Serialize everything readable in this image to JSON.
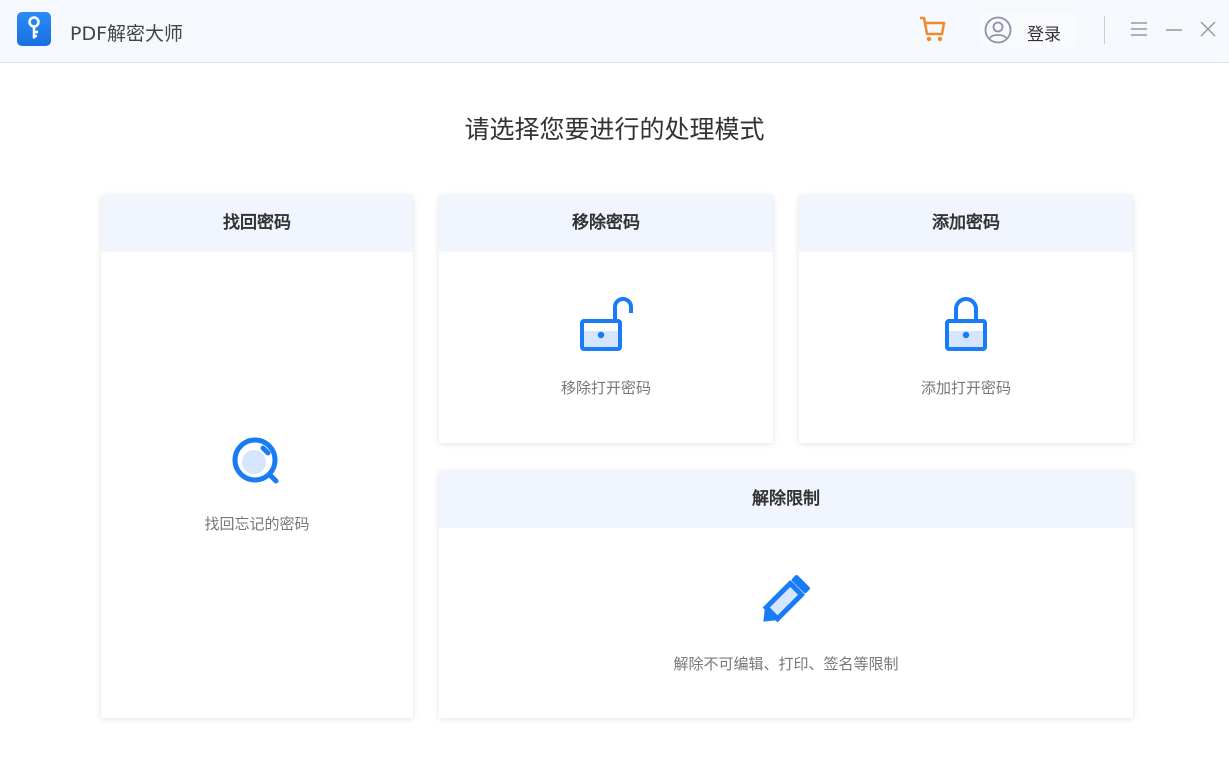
{
  "app": {
    "title": "PDF解密大师",
    "login": "登录"
  },
  "heading": "请选择您要进行的处理模式",
  "cards": [
    {
      "title": "找回密码",
      "desc": "找回忘记的密码"
    },
    {
      "title": "移除密码",
      "desc": "移除打开密码"
    },
    {
      "title": "添加密码",
      "desc": "添加打开密码"
    },
    {
      "title": "解除限制",
      "desc": "解除不可编辑、打印、签名等限制"
    }
  ],
  "colors": {
    "accent": "#1a7cf5",
    "cart": "#f08a2c"
  }
}
